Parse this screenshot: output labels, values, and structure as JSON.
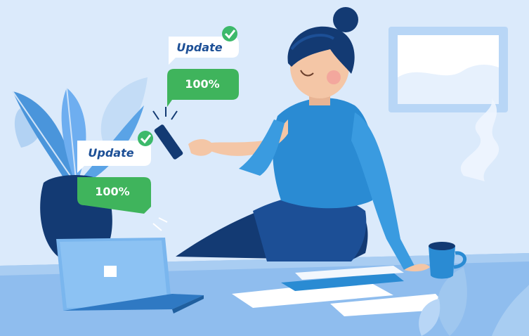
{
  "notifications": [
    {
      "title": "Update",
      "progress_label": "100%",
      "progress_value": 100
    },
    {
      "title": "Update",
      "progress_label": "100%",
      "progress_value": 100
    }
  ],
  "colors": {
    "background": "#dbeafb",
    "accent_blue": "#2a8bd3",
    "dark_navy": "#133a73",
    "bubble_green": "#3fb45c",
    "bubble_white": "#ffffff",
    "check_green": "#3cb96a",
    "skin": "#f4c6a6"
  },
  "icons": [
    "check-icon",
    "phone-icon",
    "laptop-icon",
    "coffee-cup-icon",
    "plant-icon",
    "window-icon"
  ]
}
